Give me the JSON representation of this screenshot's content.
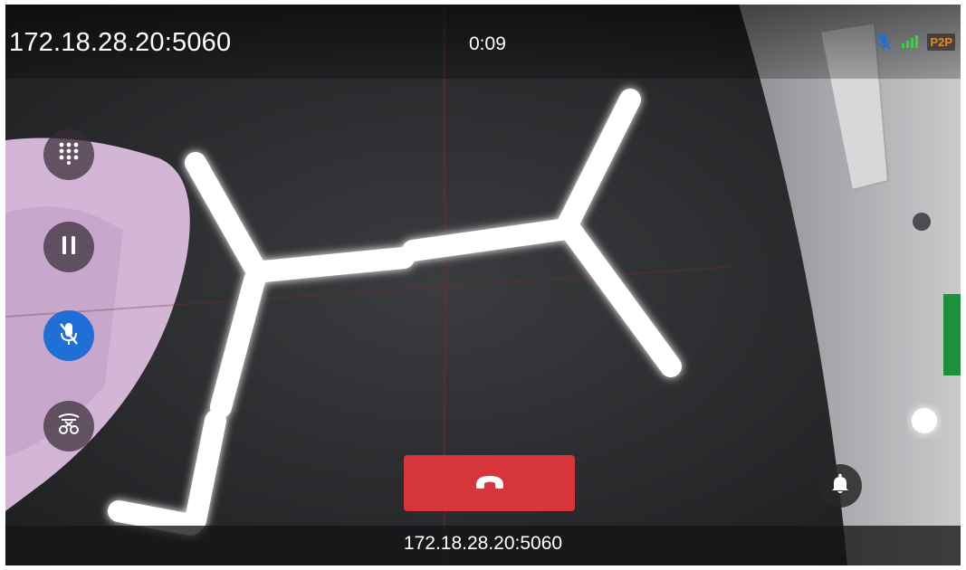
{
  "call": {
    "remote_address": "172.18.28.20:5060",
    "duration": "0:09",
    "bottom_address": "172.18.28.20:5060"
  },
  "status": {
    "mic_muted_icon": "mic-off-icon",
    "signal_icon": "signal-bars-icon",
    "connection_mode": "P2P"
  },
  "controls": {
    "side_buttons": [
      {
        "name": "dialpad-button",
        "icon": "dialpad-icon",
        "active": false
      },
      {
        "name": "hold-button",
        "icon": "pause-icon",
        "active": false
      },
      {
        "name": "mute-button",
        "icon": "mic-off-icon",
        "active": true
      },
      {
        "name": "transfer-button",
        "icon": "transfer-icon",
        "active": false
      }
    ],
    "hangup_icon": "hang-up-icon",
    "bell_icon": "bell-icon"
  },
  "colors": {
    "hangup": "#d7353c",
    "active_button": "#1f6fd6",
    "p2p": "#e28a2c",
    "signal": "#3ecf4a"
  }
}
